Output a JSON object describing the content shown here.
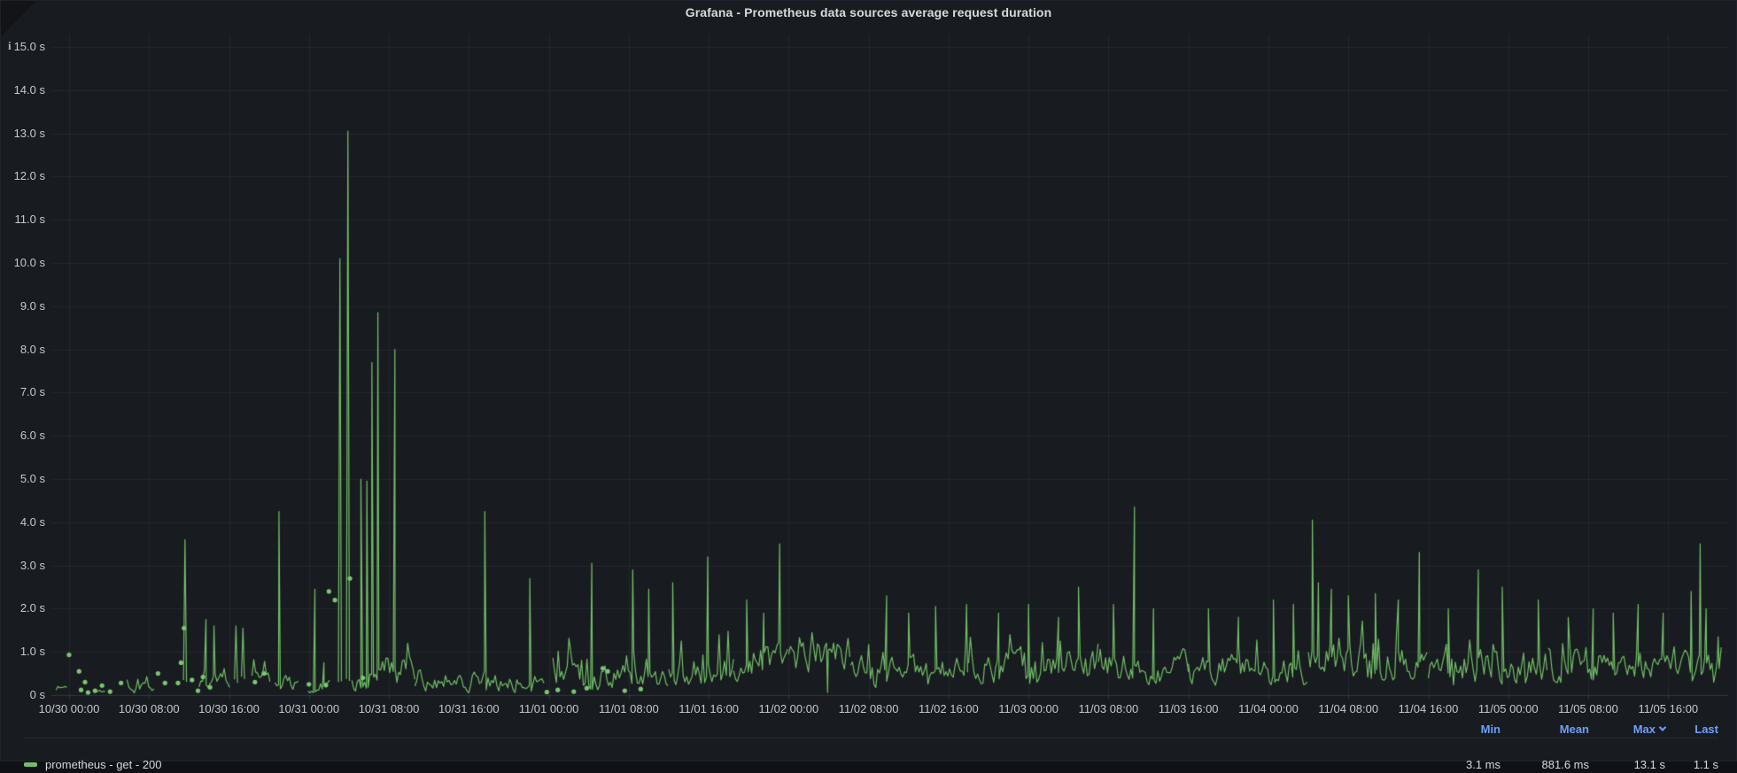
{
  "panel": {
    "title": "Grafana - Prometheus data sources average request duration",
    "info_glyph": "i"
  },
  "legend": {
    "series_label": "prometheus - get - 200",
    "stats": [
      {
        "header": "Min",
        "value": "3.1 ms"
      },
      {
        "header": "Mean",
        "value": "881.6 ms"
      },
      {
        "header": "Max",
        "value": "13.1 s",
        "sorted": true
      },
      {
        "header": "Last",
        "value": "1.1 s"
      }
    ]
  },
  "colors": {
    "series_green": "#73bf69",
    "dot_green": "#7cc674",
    "grid": "rgba(204,204,220,0.07)",
    "axis_line": "rgba(204,204,220,0.15)",
    "panel_bg": "#181b1f",
    "page_bg": "#0f1116",
    "text": "#c7c8cc",
    "link_blue": "#6e9fff"
  },
  "chart_data": {
    "type": "line",
    "title": "Grafana - Prometheus data sources average request duration",
    "series_name": "prometheus - get - 200",
    "unit": "seconds",
    "ylim": [
      0,
      15
    ],
    "y_tick_labels": [
      "0 s",
      "1.0 s",
      "2.0 s",
      "3.0 s",
      "4.0 s",
      "5.0 s",
      "6.0 s",
      "7.0 s",
      "8.0 s",
      "9.0 s",
      "10.0 s",
      "11.0 s",
      "12.0 s",
      "13.0 s",
      "14.0 s",
      "15.0 s"
    ],
    "x_range_hours": [
      -1.77,
      166.0
    ],
    "x_tick_hours": [
      0,
      8,
      16,
      24,
      32,
      40,
      48,
      56,
      64,
      72,
      80,
      88,
      96,
      104,
      112,
      120,
      128,
      136,
      144,
      152,
      160
    ],
    "x_tick_labels": [
      "10/30 00:00",
      "10/30 08:00",
      "10/30 16:00",
      "10/31 00:00",
      "10/31 08:00",
      "10/31 16:00",
      "11/01 00:00",
      "11/01 08:00",
      "11/01 16:00",
      "11/02 00:00",
      "11/02 08:00",
      "11/02 16:00",
      "11/03 00:00",
      "11/03 08:00",
      "11/03 16:00",
      "11/04 00:00",
      "11/04 08:00",
      "11/04 16:00",
      "11/05 00:00",
      "11/05 08:00",
      "11/05 16:00"
    ],
    "stats": {
      "min_s": 0.0031,
      "mean_s": 0.8816,
      "max_s": 13.1,
      "last_s": 1.1
    },
    "noise_seed": 1337,
    "sample_step_hours": 0.18,
    "baseline_segments": [
      [
        -1.3,
        -0.2,
        0.17,
        0.1,
        0,
        0
      ],
      [
        2.7,
        3.6,
        0.1,
        0.06,
        0,
        0
      ],
      [
        5.8,
        8.6,
        0.28,
        0.2,
        0.12,
        0.45
      ],
      [
        13.0,
        16.2,
        0.3,
        0.2,
        0.1,
        0.5
      ],
      [
        18.3,
        20.2,
        0.45,
        0.3,
        0.1,
        0.4
      ],
      [
        20.6,
        23.0,
        0.3,
        0.2,
        0.06,
        0.4
      ],
      [
        23.9,
        26.1,
        0.22,
        0.16,
        0.05,
        0.4
      ],
      [
        28.3,
        34.6,
        0.55,
        0.38,
        0.12,
        0.9
      ],
      [
        34.6,
        41.2,
        0.38,
        0.26,
        0.09,
        0.55
      ],
      [
        41.2,
        47.6,
        0.3,
        0.22,
        0.07,
        0.45
      ],
      [
        48.4,
        60.0,
        0.4,
        0.28,
        0.1,
        0.6
      ],
      [
        60.0,
        66.5,
        0.6,
        0.34,
        0.16,
        0.8
      ],
      [
        66.5,
        72.0,
        0.78,
        0.4,
        0.16,
        0.7
      ],
      [
        72.0,
        78.2,
        0.95,
        0.42,
        0.1,
        0.5
      ],
      [
        78.2,
        90.0,
        0.55,
        0.33,
        0.1,
        0.55
      ],
      [
        90.0,
        103.0,
        0.68,
        0.38,
        0.1,
        0.6
      ],
      [
        103.0,
        112.0,
        0.62,
        0.36,
        0.1,
        0.6
      ],
      [
        112.0,
        124.0,
        0.58,
        0.34,
        0.1,
        0.6
      ],
      [
        124.0,
        136.0,
        0.78,
        0.44,
        0.12,
        0.65
      ],
      [
        136.0,
        148.0,
        0.7,
        0.4,
        0.1,
        0.6
      ],
      [
        148.0,
        165.3,
        0.7,
        0.38,
        0.1,
        0.55
      ]
    ],
    "spikes": [
      [
        11.6,
        3.6
      ],
      [
        13.7,
        1.75
      ],
      [
        14.5,
        1.6
      ],
      [
        16.7,
        1.6
      ],
      [
        17.4,
        1.55
      ],
      [
        21.0,
        4.25
      ],
      [
        24.6,
        2.45
      ],
      [
        25.5,
        0.75
      ],
      [
        27.1,
        10.1
      ],
      [
        27.9,
        13.05
      ],
      [
        29.2,
        5.0
      ],
      [
        29.8,
        4.95
      ],
      [
        30.3,
        7.7
      ],
      [
        30.9,
        8.85
      ],
      [
        32.6,
        8.0
      ],
      [
        41.6,
        4.25
      ],
      [
        46.1,
        2.7
      ],
      [
        52.3,
        3.05
      ],
      [
        56.4,
        2.9
      ],
      [
        58.0,
        2.45
      ],
      [
        60.4,
        2.6
      ],
      [
        63.9,
        3.2
      ],
      [
        67.8,
        2.2
      ],
      [
        69.5,
        1.9
      ],
      [
        71.1,
        3.5
      ],
      [
        75.9,
        0.06
      ],
      [
        81.8,
        2.3
      ],
      [
        84.0,
        1.9
      ],
      [
        86.7,
        2.05
      ],
      [
        89.8,
        2.1
      ],
      [
        93.0,
        1.9
      ],
      [
        96.0,
        2.1
      ],
      [
        99.0,
        1.8
      ],
      [
        101.0,
        2.5
      ],
      [
        104.5,
        2.1
      ],
      [
        106.6,
        4.35
      ],
      [
        108.5,
        2.0
      ],
      [
        114.0,
        2.0
      ],
      [
        117.0,
        1.8
      ],
      [
        120.5,
        2.2
      ],
      [
        122.5,
        2.1
      ],
      [
        124.4,
        4.05
      ],
      [
        125.0,
        2.6
      ],
      [
        126.3,
        2.45
      ],
      [
        128.0,
        2.3
      ],
      [
        130.7,
        2.35
      ],
      [
        133.0,
        2.2
      ],
      [
        135.1,
        3.3
      ],
      [
        138.0,
        2.0
      ],
      [
        141.0,
        2.9
      ],
      [
        143.4,
        2.5
      ],
      [
        147.0,
        2.2
      ],
      [
        150.0,
        1.8
      ],
      [
        152.5,
        2.0
      ],
      [
        154.5,
        1.9
      ],
      [
        157.0,
        2.1
      ],
      [
        159.5,
        1.9
      ],
      [
        162.3,
        2.4
      ],
      [
        163.2,
        3.5
      ],
      [
        163.8,
        2.0
      ],
      [
        165.0,
        1.35
      ],
      [
        165.3,
        1.1
      ]
    ],
    "isolated_points": [
      [
        0.0,
        0.93
      ],
      [
        1.0,
        0.55
      ],
      [
        1.2,
        0.12
      ],
      [
        1.6,
        0.3
      ],
      [
        1.9,
        0.06
      ],
      [
        2.6,
        0.1
      ],
      [
        3.3,
        0.22
      ],
      [
        4.1,
        0.08
      ],
      [
        5.2,
        0.28
      ],
      [
        8.9,
        0.5
      ],
      [
        9.6,
        0.28
      ],
      [
        10.9,
        0.28
      ],
      [
        11.2,
        0.75
      ],
      [
        11.5,
        1.55
      ],
      [
        12.3,
        0.35
      ],
      [
        12.9,
        0.1
      ],
      [
        13.4,
        0.42
      ],
      [
        14.1,
        0.18
      ],
      [
        18.6,
        0.3
      ],
      [
        19.5,
        0.5
      ],
      [
        24.0,
        0.25
      ],
      [
        25.7,
        0.23
      ],
      [
        26.0,
        2.4
      ],
      [
        26.6,
        2.2
      ],
      [
        28.1,
        2.7
      ],
      [
        29.4,
        0.4
      ],
      [
        47.8,
        0.07
      ],
      [
        48.9,
        0.12
      ],
      [
        50.5,
        0.08
      ],
      [
        51.8,
        0.16
      ],
      [
        53.4,
        0.62
      ],
      [
        53.9,
        0.55
      ],
      [
        55.6,
        0.1
      ],
      [
        57.2,
        0.14
      ]
    ]
  }
}
